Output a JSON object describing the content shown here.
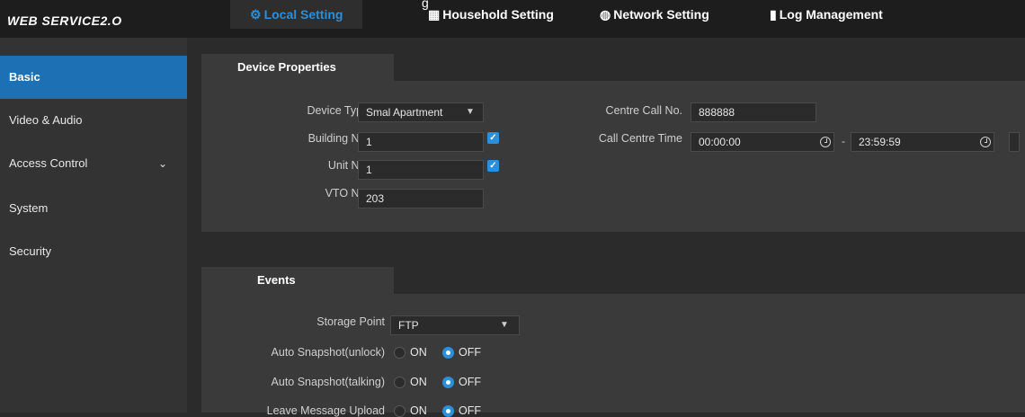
{
  "header": {
    "logo": "WEB SERVICE2.O",
    "stray_glyph": "g",
    "tabs": [
      {
        "label": "Local Setting",
        "icon": "gear-icon",
        "active": true
      },
      {
        "label": "Household Setting",
        "icon": "household-icon",
        "active": false
      },
      {
        "label": "Network Setting",
        "icon": "globe-icon",
        "active": false
      },
      {
        "label": "Log Management",
        "icon": "log-icon",
        "active": false
      }
    ]
  },
  "sidebar": {
    "items": [
      {
        "label": "Basic",
        "active": true
      },
      {
        "label": "Video & Audio"
      },
      {
        "label": "Access Control",
        "icon": "chevron-down-icon"
      },
      {
        "label": "System"
      },
      {
        "label": "Security"
      }
    ]
  },
  "device_properties": {
    "tab_label": "Device Properties",
    "device_type_label": "Device Type",
    "device_type_value": "Smal Apartment",
    "building_no_label": "Building No.",
    "building_no_value": "1",
    "building_no_checked": true,
    "unit_no_label": "Unit No.",
    "unit_no_value": "1",
    "unit_no_checked": true,
    "vto_no_label": "VTO No.",
    "vto_no_value": "203",
    "centre_call_no_label": "Centre Call No.",
    "centre_call_no_value": "888888",
    "call_centre_time_label": "Call Centre Time",
    "call_centre_time_start": "00:00:00",
    "call_centre_time_separator": "-",
    "call_centre_time_end": "23:59:59"
  },
  "events": {
    "tab_label": "Events",
    "storage_point_label": "Storage Point",
    "storage_point_value": "FTP",
    "rows": [
      {
        "label": "Auto Snapshot(unlock)",
        "on_label": "ON",
        "off_label": "OFF",
        "selected": "OFF"
      },
      {
        "label": "Auto Snapshot(talking)",
        "on_label": "ON",
        "off_label": "OFF",
        "selected": "OFF"
      },
      {
        "label": "Leave Message Upload",
        "on_label": "ON",
        "off_label": "OFF",
        "selected": "OFF"
      }
    ]
  },
  "colors": {
    "accent": "#2c8fd9",
    "sidebar_active": "#1c70b3",
    "header_bg": "#1d1d1d",
    "panel_bg": "#3a3a3a"
  }
}
